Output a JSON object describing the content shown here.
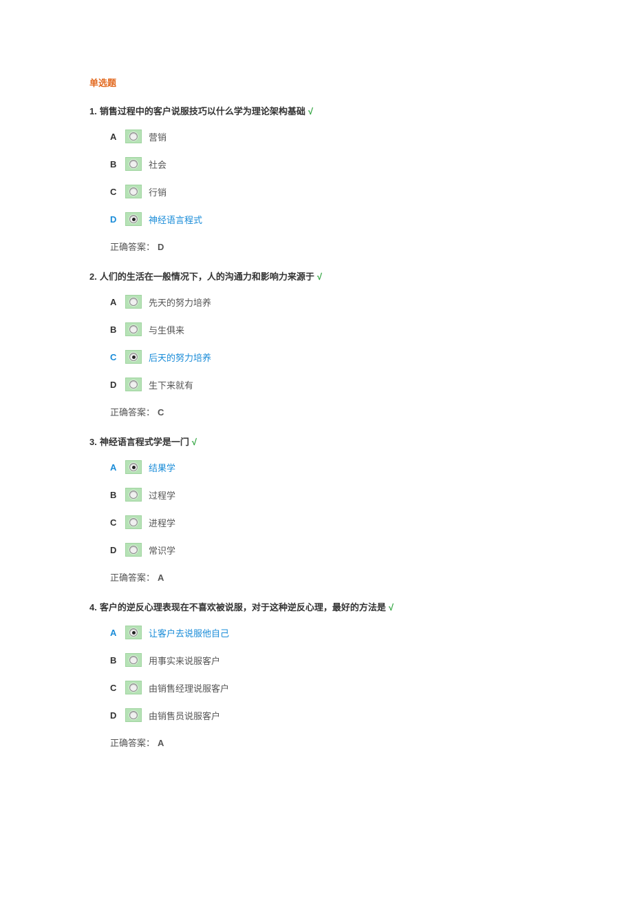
{
  "section_title": "单选题",
  "tick_mark": "√",
  "answer_label": "正确答案：",
  "questions": [
    {
      "number": "1.",
      "text": "销售过程中的客户说服技巧以什么学为理论架构基础",
      "options": [
        {
          "letter": "A",
          "text": "营销",
          "selected": false
        },
        {
          "letter": "B",
          "text": "社会",
          "selected": false
        },
        {
          "letter": "C",
          "text": "行销",
          "selected": false
        },
        {
          "letter": "D",
          "text": "神经语言程式",
          "selected": true
        }
      ],
      "answer": "D"
    },
    {
      "number": "2.",
      "text": "人们的生活在一般情况下，人的沟通力和影响力来源于",
      "options": [
        {
          "letter": "A",
          "text": "先天的努力培养",
          "selected": false
        },
        {
          "letter": "B",
          "text": "与生俱来",
          "selected": false
        },
        {
          "letter": "C",
          "text": "后天的努力培养",
          "selected": true
        },
        {
          "letter": "D",
          "text": "生下来就有",
          "selected": false
        }
      ],
      "answer": "C"
    },
    {
      "number": "3.",
      "text": "神经语言程式学是一门",
      "options": [
        {
          "letter": "A",
          "text": "结果学",
          "selected": true
        },
        {
          "letter": "B",
          "text": "过程学",
          "selected": false
        },
        {
          "letter": "C",
          "text": "进程学",
          "selected": false
        },
        {
          "letter": "D",
          "text": "常识学",
          "selected": false
        }
      ],
      "answer": "A"
    },
    {
      "number": "4.",
      "text": "客户的逆反心理表现在不喜欢被说服，对于这种逆反心理，最好的方法是",
      "options": [
        {
          "letter": "A",
          "text": "让客户去说服他自己",
          "selected": true
        },
        {
          "letter": "B",
          "text": "用事实来说服客户",
          "selected": false
        },
        {
          "letter": "C",
          "text": "由销售经理说服客户",
          "selected": false
        },
        {
          "letter": "D",
          "text": "由销售员说服客户",
          "selected": false
        }
      ],
      "answer": "A"
    }
  ]
}
